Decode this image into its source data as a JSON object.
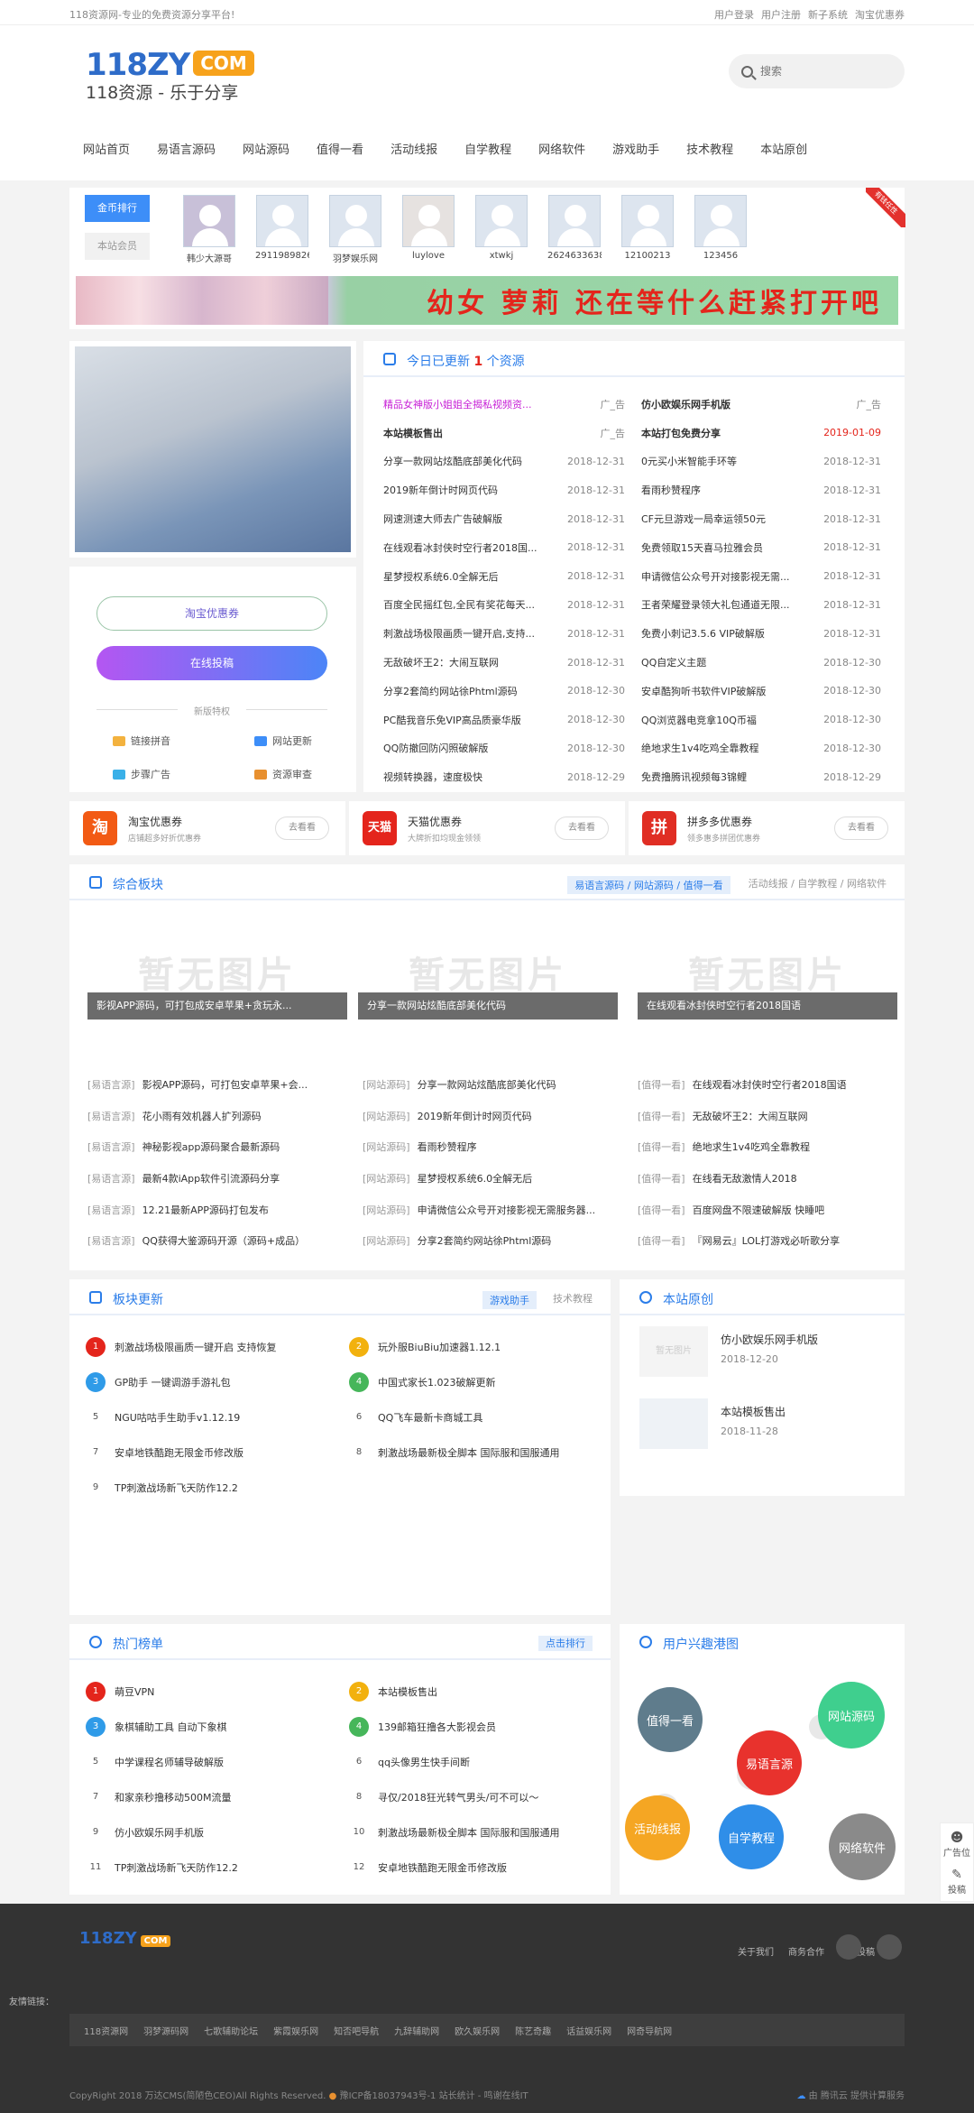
{
  "topbar": {
    "tagline": "118资源网-专业的免费资源分享平台!",
    "links": [
      "用户登录",
      "用户注册",
      "新子系统",
      "淘宝优惠券"
    ]
  },
  "logo": {
    "main": "118ZY",
    "com": "COM",
    "sub": "118资源 - 乐于分享"
  },
  "search": {
    "placeholder": "搜索"
  },
  "nav": [
    "网站首页",
    "易语言源码",
    "网站源码",
    "值得一看",
    "活动线报",
    "自学教程",
    "网络软件",
    "游戏助手",
    "技术教程",
    "本站原创"
  ],
  "rank": {
    "tab_active": "金币排行",
    "tab_other": "本站会员",
    "ribbon": "有钱任性",
    "users": [
      "韩少大源哥",
      "2911989826",
      "羽梦娱乐网",
      "luylove",
      "xtwkj",
      "2624633638",
      "12100213",
      "123456"
    ]
  },
  "banner": {
    "text": "幼女 萝莉 还在等什么赶紧打开吧"
  },
  "side": {
    "btn1": "淘宝优惠券",
    "btn2": "在线投稿",
    "divider": "新版特权",
    "links": [
      "链接拼音",
      "网站更新",
      "步骤广告",
      "资源审查"
    ]
  },
  "news": {
    "title_pre": "今日已更新",
    "count": "1",
    "title_post": "个资源",
    "rows": [
      [
        "精品女神版小姐姐全揭私视频资...",
        "广_告",
        "仿小欧娱乐网手机版",
        "广_告"
      ],
      [
        "本站模板售出",
        "广_告",
        "本站打包免费分享",
        "2019-01-09"
      ],
      [
        "分享一款网站炫酷底部美化代码",
        "2018-12-31",
        "0元买小米智能手环等",
        "2018-12-31"
      ],
      [
        "2019新年倒计时网页代码",
        "2018-12-31",
        "看雨秒赞程序",
        "2018-12-31"
      ],
      [
        "网速测速大师去广告破解版",
        "2018-12-31",
        "CF元旦游戏一局幸运领50元",
        "2018-12-31"
      ],
      [
        "在线观看冰封侠时空行者2018国...",
        "2018-12-31",
        "免费领取15天喜马拉雅会员",
        "2018-12-31"
      ],
      [
        "星梦授权系统6.0全解无后",
        "2018-12-31",
        "申请微信公众号开对接影视无需...",
        "2018-12-31"
      ],
      [
        "百度全民摇红包,全民有奖花每天...",
        "2018-12-31",
        "王者荣耀登录领大礼包通道无限...",
        "2018-12-31"
      ],
      [
        "刺激战场极限画质一键开启,支持...",
        "2018-12-31",
        "免费小刺记3.5.6 VIP破解版",
        "2018-12-31"
      ],
      [
        "无敌破坏王2：大闹互联网",
        "2018-12-31",
        "QQ自定义主题",
        "2018-12-30"
      ],
      [
        "分享2套简约网站徐Phtml源码",
        "2018-12-30",
        "安卓酷狗听书软件VIP破解版",
        "2018-12-30"
      ],
      [
        "PC酷我音乐免VIP高品质豪华版",
        "2018-12-30",
        "QQ浏览器电竞拿10Q币福",
        "2018-12-30"
      ],
      [
        "QQ防撤回防闪照破解版",
        "2018-12-30",
        "绝地求生1v4吃鸡全靠教程",
        "2018-12-30"
      ],
      [
        "视频转换器，速度极快",
        "2018-12-29",
        "免费撸腾讯视频每3锦鲤",
        "2018-12-29"
      ]
    ]
  },
  "coupons": [
    {
      "logo": "淘",
      "name": "淘宝优惠券",
      "desc": "店铺超多好折优惠券",
      "go": "去看看",
      "color": "#f25a14"
    },
    {
      "logo": "天猫",
      "name": "天猫优惠券",
      "desc": "大牌折扣均现金领领",
      "go": "去看看",
      "color": "#e4251c"
    },
    {
      "logo": "拼",
      "name": "拼多多优惠券",
      "desc": "领多惠多拼团优惠券",
      "go": "去看看",
      "color": "#e02e24"
    }
  ],
  "zh": {
    "title": "综合板块",
    "tabs_on": "易语言源码 / 网站源码 / 值得一看",
    "tabs_off": "活动线报 / 自学教程 / 网络软件",
    "placeholder": "暂无图片",
    "caps": [
      "影视APP源码，可打包成安卓苹果+贪玩永...",
      "分享一款网站炫酷底部美化代码",
      "在线观看冰封侠时空行者2018国语"
    ],
    "cols": [
      [
        [
          "[易语言源]",
          "影视APP源码，可打包安卓苹果+会..."
        ],
        [
          "[易语言源]",
          "花小雨有效机器人扩列源码"
        ],
        [
          "[易语言源]",
          "神秘影视app源码聚合最新源码"
        ],
        [
          "[易语言源]",
          "最新4款iApp软件引流源码分享"
        ],
        [
          "[易语言源]",
          "12.21最新APP源码打包发布"
        ],
        [
          "[易语言源]",
          "QQ获得大鉴源码开源（源码+成品）"
        ]
      ],
      [
        [
          "[网站源码]",
          "分享一款网站炫酷底部美化代码"
        ],
        [
          "[网站源码]",
          "2019新年倒计时网页代码"
        ],
        [
          "[网站源码]",
          "看雨秒赞程序"
        ],
        [
          "[网站源码]",
          "星梦授权系统6.0全解无后"
        ],
        [
          "[网站源码]",
          "申请微信公众号开对接影视无需服务器..."
        ],
        [
          "[网站源码]",
          "分享2套简约网站徐Phtml源码"
        ]
      ],
      [
        [
          "[值得一看]",
          "在线观看冰封侠时空行者2018国语"
        ],
        [
          "[值得一看]",
          "无敌破坏王2：大闹互联网"
        ],
        [
          "[值得一看]",
          "绝地求生1v4吃鸡全靠教程"
        ],
        [
          "[值得一看]",
          "在线看无敌激情人2018"
        ],
        [
          "[值得一看]",
          "百度网盘不限速破解版 快睡吧"
        ],
        [
          "[值得一看]",
          "『网易云』LOL打游戏必听歌分享"
        ]
      ]
    ]
  },
  "bk": {
    "title": "板块更新",
    "tab_on": "游戏助手",
    "tab_off": "技术教程",
    "items": [
      "刺激战场极限画质一键开启 支持恢复",
      "玩外服BiuBiu加速器1.12.1",
      "GP助手 一键调游手游礼包",
      "中国式家长1.023破解更新",
      "NGU咕咕手生助手v1.12.19",
      "QQ飞车最新卡商城工具",
      "安卓地铁酷跑无限金币修改版",
      "刺激战场最新极全脚本 国际服和国服通用",
      "TP刺激战场新飞天防作12.2"
    ]
  },
  "yc": {
    "title": "本站原创",
    "items": [
      {
        "thumb": "暂无图片",
        "title": "仿小欧娱乐网手机版",
        "date": "2018-12-20"
      },
      {
        "thumb": "",
        "title": "本站模板售出",
        "date": "2018-11-28"
      }
    ]
  },
  "rm": {
    "title": "热门榜单",
    "tab": "点击排行",
    "items": [
      "萌豆VPN",
      "本站模板售出",
      "象棋辅助工具 自动下象棋",
      "139邮箱狂撸各大影视会员",
      "中学课程名师辅导破解版",
      "qq头像男生快手间断",
      "和家亲秒撸移动500M流量",
      "寻仅/2018狂光转气男头/可不可以～",
      "仿小欧娱乐网手机版",
      "刺激战场最新极全脚本 国际服和国服通用",
      "TP刺激战场新飞天防作12.2",
      "安卓地铁酷跑无限金币修改版"
    ]
  },
  "xq": {
    "title": "用户兴趣港图",
    "bubbles": [
      "值得一看",
      "网站源码",
      "易语言源",
      "活动线报",
      "自学教程",
      "网络软件"
    ]
  },
  "float": {
    "a": "广告位",
    "b": "投稿"
  },
  "footer": {
    "logo": "118ZY",
    "com": "COM",
    "links": [
      "关于我们",
      "商务合作",
      "教程投稿"
    ],
    "friend": "友情链接：",
    "friends": [
      "118资源网",
      "羽梦源码网",
      "七歌辅助论坛",
      "紫霞娱乐网",
      "知否吧导航",
      "九辞辅助网",
      "欧久娱乐网",
      "陈艺奇趣",
      "话益娱乐网",
      "网奇导航网"
    ],
    "copy": "CopyRight 2018 万达CMS(简陋色CEO)All Rights Reserved.",
    "icp": "豫ICP备18037943号-1",
    "icp2": "站长统计 - 鸣谢在线IT",
    "cloud": "由 腾讯云 提供计算服务"
  }
}
